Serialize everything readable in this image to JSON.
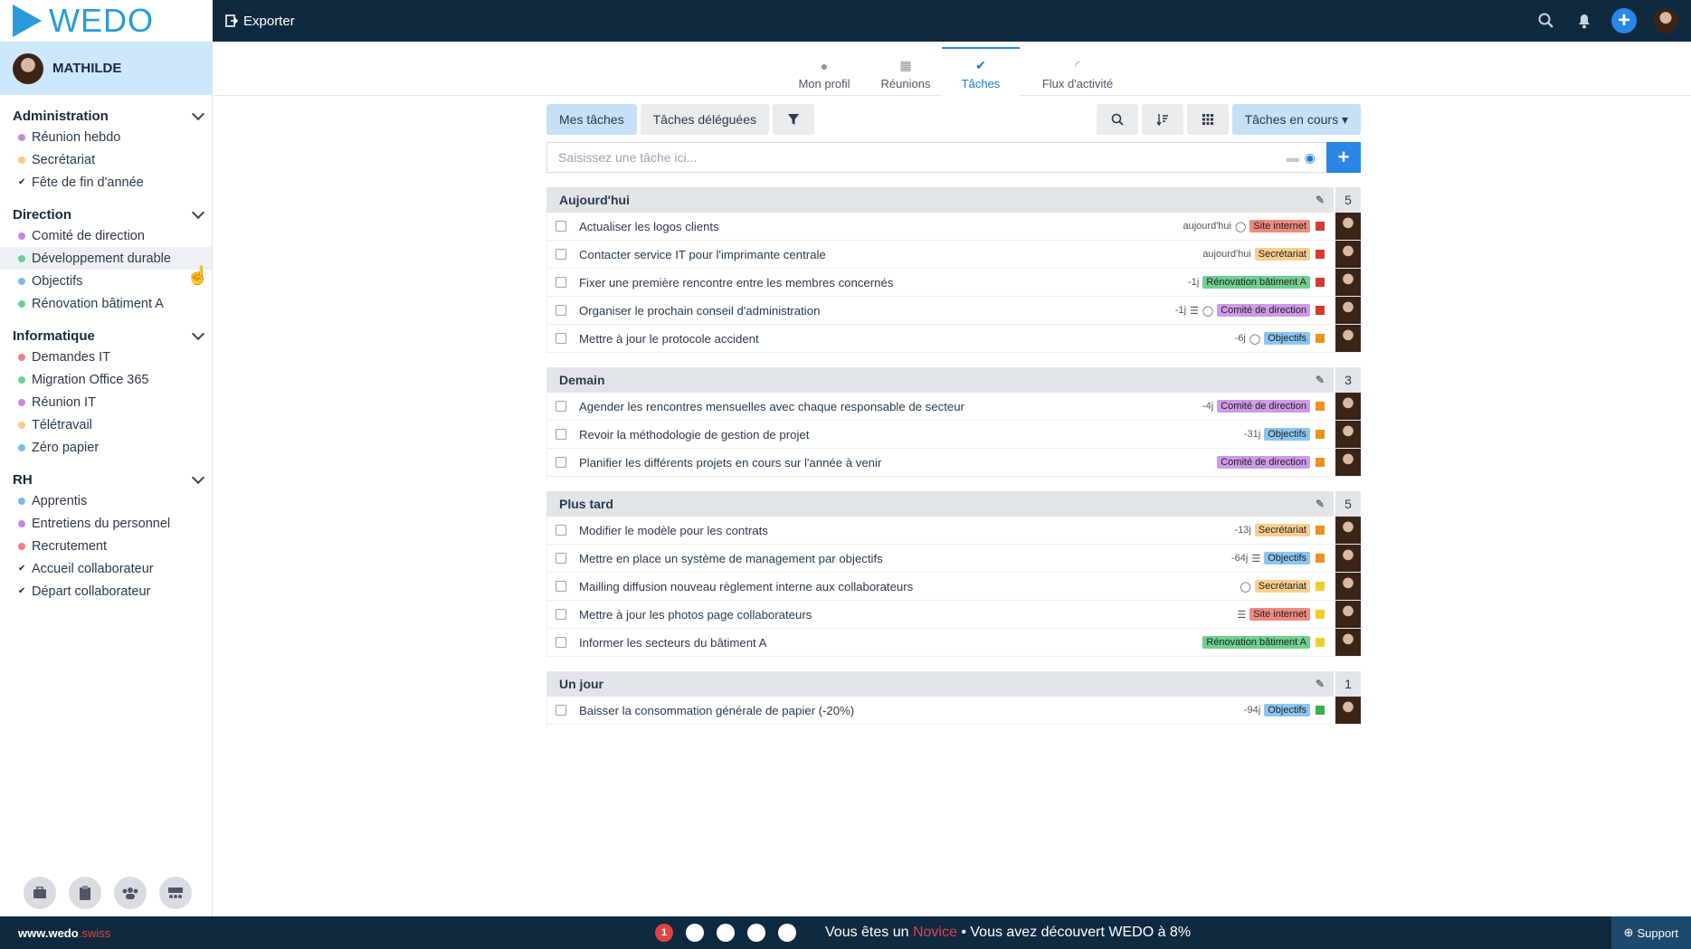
{
  "logo": "WEDO",
  "topbar": {
    "export_label": "Exporter"
  },
  "user": {
    "name": "MATHILDE"
  },
  "sidebar": {
    "groups": [
      {
        "title": "Administration",
        "items": [
          {
            "label": "Réunion hebdo",
            "color": "#c58be0",
            "kind": "dot"
          },
          {
            "label": "Secrétariat",
            "color": "#f7c98b",
            "kind": "dot"
          },
          {
            "label": "Fête de fin d'année",
            "color": "#1a2a3a",
            "kind": "check"
          }
        ]
      },
      {
        "title": "Direction",
        "items": [
          {
            "label": "Comité de direction",
            "color": "#c58be0",
            "kind": "dot"
          },
          {
            "label": "Développement durable",
            "color": "#6fd08f",
            "kind": "dot"
          },
          {
            "label": "Objectifs",
            "color": "#7bbbe8",
            "kind": "dot"
          },
          {
            "label": "Rénovation bâtiment A",
            "color": "#6fd08f",
            "kind": "dot"
          }
        ]
      },
      {
        "title": "Informatique",
        "items": [
          {
            "label": "Demandes IT",
            "color": "#f08080",
            "kind": "dot"
          },
          {
            "label": "Migration Office 365",
            "color": "#6fd08f",
            "kind": "dot"
          },
          {
            "label": "Réunion IT",
            "color": "#c58be0",
            "kind": "dot"
          },
          {
            "label": "Télétravail",
            "color": "#f7c98b",
            "kind": "dot"
          },
          {
            "label": "Zéro papier",
            "color": "#7bbbe8",
            "kind": "dot"
          }
        ]
      },
      {
        "title": "RH",
        "items": [
          {
            "label": "Apprentis",
            "color": "#7bbbe8",
            "kind": "dot"
          },
          {
            "label": "Entretiens du personnel",
            "color": "#c58be0",
            "kind": "dot"
          },
          {
            "label": "Recrutement",
            "color": "#f08080",
            "kind": "dot"
          },
          {
            "label": "Accueil collaborateur",
            "color": "#1a2a3a",
            "kind": "check"
          },
          {
            "label": "Départ collaborateur",
            "color": "#1a2a3a",
            "kind": "check"
          }
        ]
      }
    ]
  },
  "tabs": [
    {
      "label": "Mon profil",
      "icon": "user-icon"
    },
    {
      "label": "Réunions",
      "icon": "calendar-icon"
    },
    {
      "label": "Tâches",
      "icon": "check-icon",
      "active": true
    },
    {
      "label": "Flux d'activité",
      "icon": "rss-icon"
    }
  ],
  "toolbar": {
    "my_tasks": "Mes tâches",
    "delegated": "Tâches déléguées",
    "status_select": "Tâches en cours ▾"
  },
  "task_input": {
    "placeholder": "Saisissez une tâche ici..."
  },
  "tag_colors": {
    "Site internet": "#f08a80",
    "Secrétariat": "#f9cf8f",
    "Rénovation bâtiment A": "#6fd08f",
    "Comité de direction": "#cf9ae6",
    "Objectifs": "#8cc6f0"
  },
  "priority_colors": {
    "red": "#d63a2f",
    "orange": "#f0901e",
    "yellow": "#f2cd2a",
    "green": "#3cae4f"
  },
  "sections": [
    {
      "title": "Aujourd'hui",
      "count": "5",
      "tasks": [
        {
          "text": "Actualiser les logos clients",
          "due": "aujourd'hui",
          "icons": [
            "comment"
          ],
          "tag": "Site internet",
          "prio": "red"
        },
        {
          "text": "Contacter service IT pour l'imprimante centrale",
          "due": "aujourd'hui",
          "icons": [],
          "tag": "Secrétariat",
          "prio": "red"
        },
        {
          "text": "Fixer une première rencontre entre les membres concernés",
          "due": "-1j",
          "icons": [],
          "tag": "Rénovation bâtiment A",
          "prio": "red"
        },
        {
          "text": "Organiser le prochain conseil d'administration",
          "due": "-1j",
          "icons": [
            "list",
            "comment"
          ],
          "tag": "Comité de direction",
          "prio": "red"
        },
        {
          "text": "Mettre à jour le protocole accident",
          "due": "-6j",
          "icons": [
            "comment"
          ],
          "tag": "Objectifs",
          "prio": "orange"
        }
      ]
    },
    {
      "title": "Demain",
      "count": "3",
      "tasks": [
        {
          "text": "Agender les rencontres mensuelles avec chaque responsable de secteur",
          "due": "-4j",
          "icons": [],
          "tag": "Comité de direction",
          "prio": "orange"
        },
        {
          "text": "Revoir la méthodologie de gestion de projet",
          "due": "-31j",
          "icons": [],
          "tag": "Objectifs",
          "prio": "orange"
        },
        {
          "text": "Planifier les différents projets en cours sur l'année à venir",
          "due": "",
          "icons": [],
          "tag": "Comité de direction",
          "prio": "orange"
        }
      ]
    },
    {
      "title": "Plus tard",
      "count": "5",
      "tasks": [
        {
          "text": "Modifier le modèle pour les contrats",
          "due": "-13j",
          "icons": [],
          "tag": "Secrétariat",
          "prio": "orange"
        },
        {
          "text": "Mettre en place un système de management par objectifs",
          "due": "-64j",
          "icons": [
            "list"
          ],
          "tag": "Objectifs",
          "prio": "orange"
        },
        {
          "text": "Mailling diffusion nouveau règlement interne aux collaborateurs",
          "due": "",
          "icons": [
            "comment"
          ],
          "tag": "Secrétariat",
          "prio": "yellow"
        },
        {
          "text": "Mettre à jour les photos page collaborateurs",
          "due": "",
          "icons": [
            "list"
          ],
          "tag": "Site internet",
          "prio": "yellow"
        },
        {
          "text": "Informer les secteurs du bâtiment A",
          "due": "",
          "icons": [],
          "tag": "Rénovation bâtiment A",
          "prio": "yellow"
        }
      ]
    },
    {
      "title": "Un jour",
      "count": "1",
      "tasks": [
        {
          "text": "Baisser la consommation générale de papier (-20%)",
          "due": "-94j",
          "icons": [],
          "tag": "Objectifs",
          "prio": "green"
        }
      ]
    }
  ],
  "bottom": {
    "site_prefix": "www.wedo",
    "site_suffix": ".swiss",
    "progress_first": "1",
    "novice_a": "Vous êtes un",
    "novice_level": "Novice",
    "novice_b": "• Vous avez découvert WEDO à 8%",
    "support": "Support"
  }
}
